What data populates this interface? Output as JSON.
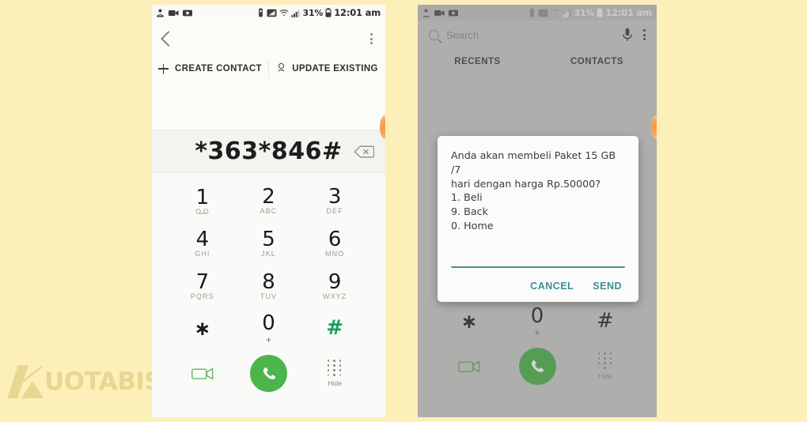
{
  "page": {
    "background_color": "#fdefb8",
    "watermark_text": "UOTABISA.COM",
    "watermark_k": "K"
  },
  "left_phone": {
    "statusbar": {
      "left_icons": [
        "contacts-sync-icon",
        "video-recorder-icon",
        "screen-recorder-icon"
      ],
      "right_icons": [
        "vibrate-icon",
        "cast-icon",
        "wifi-icon",
        "signal-icon",
        "battery-icon"
      ],
      "battery_percent": "31%",
      "time": "12:01 am"
    },
    "appbar": {
      "back_icon": "back-chevron-icon",
      "menu_icon": "overflow-menu-icon"
    },
    "contact_actions": [
      {
        "label": "CREATE CONTACT",
        "icon": "plus-icon"
      },
      {
        "label": "UPDATE EXISTING",
        "icon": "person-icon"
      }
    ],
    "dialed_number": "*363*846#",
    "backspace_icon": "backspace-icon",
    "keypad": [
      [
        {
          "digit": "1",
          "sub": "∞",
          "sub_kind": "voicemail",
          "green": false
        },
        {
          "digit": "2",
          "sub": "ABC",
          "sub_kind": "letters",
          "green": false
        },
        {
          "digit": "3",
          "sub": "DEF",
          "sub_kind": "letters",
          "green": false
        }
      ],
      [
        {
          "digit": "4",
          "sub": "GHI",
          "sub_kind": "letters",
          "green": false
        },
        {
          "digit": "5",
          "sub": "JKL",
          "sub_kind": "letters",
          "green": false
        },
        {
          "digit": "6",
          "sub": "MNO",
          "sub_kind": "letters",
          "green": false
        }
      ],
      [
        {
          "digit": "7",
          "sub": "PQRS",
          "sub_kind": "letters",
          "green": false
        },
        {
          "digit": "8",
          "sub": "TUV",
          "sub_kind": "letters",
          "green": false
        },
        {
          "digit": "9",
          "sub": "WXYZ",
          "sub_kind": "letters",
          "green": false
        }
      ],
      [
        {
          "digit": "∗",
          "sub": "",
          "sub_kind": "none",
          "green": false
        },
        {
          "digit": "0",
          "sub": "+",
          "sub_kind": "plus",
          "green": false
        },
        {
          "digit": "#",
          "sub": "",
          "sub_kind": "none",
          "green": true
        }
      ]
    ],
    "bottom_bar": {
      "video_call_icon": "video-call-icon",
      "call_icon": "call-icon",
      "hide_keypad_icon": "keypad-dots-icon",
      "hide_label": "Hide"
    },
    "accent_colors": {
      "call_green": "#4cb54c",
      "hash_green": "#16a05e",
      "back_chevron": "#7e8a6a"
    }
  },
  "right_phone": {
    "statusbar": {
      "battery_percent": "31%",
      "time": "12:01 am"
    },
    "search": {
      "icon": "search-icon",
      "placeholder": "Search",
      "mic_icon": "microphone-icon",
      "menu_icon": "overflow-menu-icon"
    },
    "tabs": [
      {
        "label": "RECENTS"
      },
      {
        "label": "CONTACTS"
      }
    ],
    "keypad_rows": [
      [
        {
          "digit": "7",
          "sub": "PQRS"
        },
        {
          "digit": "8",
          "sub": "TUV"
        },
        {
          "digit": "9",
          "sub": "WXYZ"
        }
      ],
      [
        {
          "digit": "∗",
          "sub": ""
        },
        {
          "digit": "0",
          "sub": "+"
        },
        {
          "digit": "#",
          "sub": ""
        }
      ]
    ],
    "bottom_bar": {
      "video_call_icon": "video-call-icon",
      "call_icon": "call-icon",
      "hide_keypad_icon": "keypad-dots-icon",
      "hide_label": "Hide"
    },
    "ussd_dialog": {
      "message": "Anda akan membeli Paket 15 GB /7\nhari dengan harga Rp.50000?\n1. Beli\n9. Back\n0. Home",
      "input_value": "",
      "cancel_label": "CANCEL",
      "send_label": "SEND",
      "accent_color": "#3f8f8f"
    }
  }
}
